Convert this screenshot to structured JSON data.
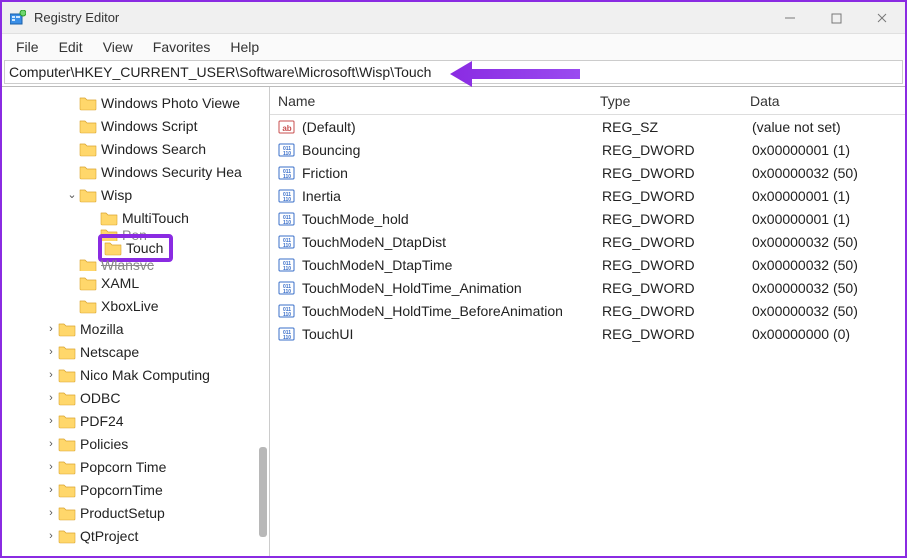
{
  "titlebar": {
    "title": "Registry Editor"
  },
  "menu": {
    "file": "File",
    "edit": "Edit",
    "view": "View",
    "favorites": "Favorites",
    "help": "Help"
  },
  "address": {
    "path": "Computer\\HKEY_CURRENT_USER\\Software\\Microsoft\\Wisp\\Touch"
  },
  "columns": {
    "name": "Name",
    "type": "Type",
    "data": "Data"
  },
  "tree": [
    {
      "label": "Windows Photo Viewe",
      "depth": 3,
      "exp": ""
    },
    {
      "label": "Windows Script",
      "depth": 3,
      "exp": ""
    },
    {
      "label": "Windows Search",
      "depth": 3,
      "exp": ""
    },
    {
      "label": "Windows Security Hea",
      "depth": 3,
      "exp": ""
    },
    {
      "label": "Wisp",
      "depth": 3,
      "exp": "v"
    },
    {
      "label": "MultiTouch",
      "depth": 4,
      "exp": ""
    },
    {
      "label": "Pen",
      "depth": 4,
      "exp": "",
      "struck": true
    },
    {
      "label": "Touch",
      "depth": 4,
      "exp": "",
      "highlight": true,
      "struck_prev": true
    },
    {
      "label": "Wlansvc",
      "depth": 3,
      "exp": "",
      "struck": true
    },
    {
      "label": "XAML",
      "depth": 3,
      "exp": ""
    },
    {
      "label": "XboxLive",
      "depth": 3,
      "exp": ""
    },
    {
      "label": "Mozilla",
      "depth": 2,
      "exp": ">"
    },
    {
      "label": "Netscape",
      "depth": 2,
      "exp": ">"
    },
    {
      "label": "Nico Mak Computing",
      "depth": 2,
      "exp": ">"
    },
    {
      "label": "ODBC",
      "depth": 2,
      "exp": ">"
    },
    {
      "label": "PDF24",
      "depth": 2,
      "exp": ">"
    },
    {
      "label": "Policies",
      "depth": 2,
      "exp": ">"
    },
    {
      "label": "Popcorn Time",
      "depth": 2,
      "exp": ">"
    },
    {
      "label": "PopcornTime",
      "depth": 2,
      "exp": ">"
    },
    {
      "label": "ProductSetup",
      "depth": 2,
      "exp": ">"
    },
    {
      "label": "QtProject",
      "depth": 2,
      "exp": ">"
    }
  ],
  "values": [
    {
      "name": "(Default)",
      "type": "REG_SZ",
      "data": "(value not set)",
      "icon": "sz"
    },
    {
      "name": "Bouncing",
      "type": "REG_DWORD",
      "data": "0x00000001 (1)",
      "icon": "dw"
    },
    {
      "name": "Friction",
      "type": "REG_DWORD",
      "data": "0x00000032 (50)",
      "icon": "dw"
    },
    {
      "name": "Inertia",
      "type": "REG_DWORD",
      "data": "0x00000001 (1)",
      "icon": "dw"
    },
    {
      "name": "TouchMode_hold",
      "type": "REG_DWORD",
      "data": "0x00000001 (1)",
      "icon": "dw"
    },
    {
      "name": "TouchModeN_DtapDist",
      "type": "REG_DWORD",
      "data": "0x00000032 (50)",
      "icon": "dw"
    },
    {
      "name": "TouchModeN_DtapTime",
      "type": "REG_DWORD",
      "data": "0x00000032 (50)",
      "icon": "dw"
    },
    {
      "name": "TouchModeN_HoldTime_Animation",
      "type": "REG_DWORD",
      "data": "0x00000032 (50)",
      "icon": "dw"
    },
    {
      "name": "TouchModeN_HoldTime_BeforeAnimation",
      "type": "REG_DWORD",
      "data": "0x00000032 (50)",
      "icon": "dw"
    },
    {
      "name": "TouchUI",
      "type": "REG_DWORD",
      "data": "0x00000000 (0)",
      "icon": "dw"
    }
  ]
}
